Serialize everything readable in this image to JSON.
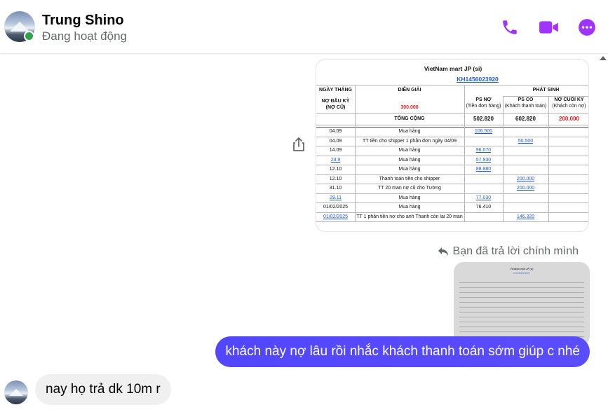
{
  "header": {
    "name": "Trung Shino",
    "status": "Đang hoạt động"
  },
  "colors": {
    "accent": "#a033ff",
    "outgoing_bubble": "#5246ff",
    "incoming_bubble": "#f0f0f0",
    "online": "#31a24c"
  },
  "icons": {
    "call": "phone-icon",
    "video": "video-camera-icon",
    "more": "more-options-icon",
    "share": "share-icon",
    "reply": "reply-arrow-icon"
  },
  "sheet": {
    "title": "VietNam mart JP (si)",
    "code": "KH1456023920",
    "headers": {
      "date": "NGÀY THÁNG",
      "desc": "DIỄN GIẢI",
      "phat_sinh": "PHÁT SINH",
      "ps_no": "PS NỢ",
      "ps_no_sub": "(Tiền đơn hàng)",
      "ps_co": "PS CÓ",
      "ps_co_sub": "(Khách thanh toán)",
      "no_cuoi": "NỢ CUỐI KỲ",
      "no_cuoi_sub": "(Khách còn nợ)",
      "no_dau": "NỢ ĐẦU KỲ",
      "no_dau_sub": "(NỢ CŨ)",
      "no_dau_value": "300.000"
    },
    "total": {
      "label": "TỔNG CỘNG",
      "ps_no": "502.820",
      "ps_co": "602.820",
      "no_cuoi": "200.000"
    },
    "rows": [
      {
        "date": "04.09",
        "desc": "Mua hàng",
        "no": "106.500",
        "co": ""
      },
      {
        "date": "04.09",
        "desc": "TT tiền cho shipper 1 phần đơn ngày 04/09",
        "no": "",
        "co": "50.500"
      },
      {
        "date": "14.09",
        "desc": "Mua hàng",
        "no": "96.070",
        "co": ""
      },
      {
        "date": "23.9",
        "desc": "Mua hàng",
        "no": "57.930",
        "co": ""
      },
      {
        "date": "12.10",
        "desc": "Mua hàng",
        "no": "88.880",
        "co": ""
      },
      {
        "date": "12.10",
        "desc": "Thanh toán tiền cho shipper",
        "no": "",
        "co": "200.000"
      },
      {
        "date": "31.10",
        "desc": "TT 20 man nợ cũ cho Tường",
        "no": "",
        "co": "200.000"
      },
      {
        "date": "29.11",
        "desc": "Mua hàng",
        "no": "77.030",
        "co": ""
      },
      {
        "date": "01/02/2025",
        "desc": "Mua hàng",
        "no": "76.410",
        "co": ""
      },
      {
        "date": "01/02/2025",
        "desc": "TT 1 phần tiền nợ cho anh Thanh còn lại 20 man",
        "no": "",
        "co": "146.320"
      }
    ]
  },
  "reply": {
    "label": "Bạn đã trả lời chính mình"
  },
  "messages": {
    "outgoing": "khách này nợ lâu rồi nhắc khách thanh toán sớm giúp c nhé",
    "incoming": "nay họ trả dk 10m r"
  }
}
